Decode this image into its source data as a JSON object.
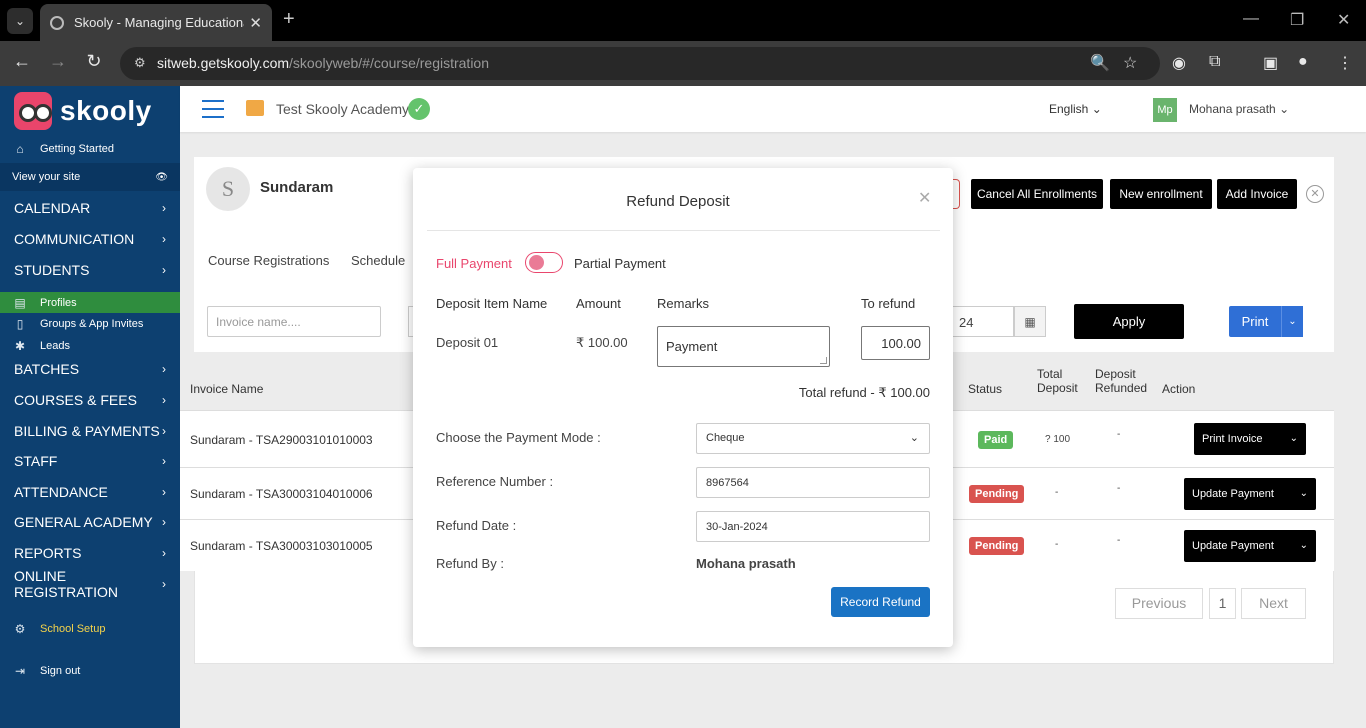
{
  "browser": {
    "tab_title": "Skooly - Managing Educational",
    "url_host": "sitweb.getskooly.com",
    "url_path": "/skoolyweb/#/course/registration"
  },
  "sidebar": {
    "brand": "skooly",
    "getting_started": "Getting Started",
    "view_site": "View your site",
    "menu": [
      {
        "label": "CALENDAR"
      },
      {
        "label": "COMMUNICATION"
      },
      {
        "label": "STUDENTS"
      }
    ],
    "students_sub": [
      {
        "label": "Profiles"
      },
      {
        "label": "Groups & App Invites"
      },
      {
        "label": "Leads"
      }
    ],
    "menu2": [
      {
        "label": "BATCHES"
      },
      {
        "label": "COURSES & FEES"
      },
      {
        "label": "BILLING & PAYMENTS"
      },
      {
        "label": "STAFF"
      },
      {
        "label": "ATTENDANCE"
      },
      {
        "label": "GENERAL ACADEMY"
      },
      {
        "label": "REPORTS"
      },
      {
        "label": "ONLINE REGISTRATION"
      }
    ],
    "school_setup": "School Setup",
    "sign_out": "Sign out"
  },
  "header": {
    "school_name": "Test Skooly Academy",
    "language": "English",
    "user_initials": "Mp",
    "user_name": "Mohana prasath"
  },
  "student": {
    "initial": "S",
    "name": "Sundaram"
  },
  "actions": {
    "cancel_all": "Cancel All Enrollments",
    "new_enrollment": "New enrollment",
    "add_invoice": "Add Invoice"
  },
  "tabs": {
    "course_registrations": "Course Registrations",
    "schedule": "Schedule"
  },
  "filters": {
    "invoice_placeholder": "Invoice name....",
    "date_tail": "24",
    "apply": "Apply",
    "print": "Print"
  },
  "table": {
    "headers": {
      "invoice_name": "Invoice Name",
      "status": "Status",
      "total_deposit": "Total Deposit",
      "deposit_refunded": "Deposit Refunded",
      "action": "Action"
    },
    "rows": [
      {
        "name": "Sundaram - TSA29003101010003",
        "status": "Paid",
        "status_color": "#5cb85c",
        "total_deposit": "? 100",
        "refunded": "-",
        "action": "Print Invoice"
      },
      {
        "name": "Sundaram - TSA30003104010006",
        "status": "Pending",
        "status_color": "#d9534f",
        "total_deposit": "-",
        "refunded": "-",
        "action": "Update Payment"
      },
      {
        "name": "Sundaram - TSA30003103010005",
        "status": "Pending",
        "status_color": "#d9534f",
        "total_deposit": "-",
        "refunded": "-",
        "action": "Update Payment"
      }
    ],
    "pagination": {
      "previous": "Previous",
      "page": "1",
      "next": "Next"
    }
  },
  "modal": {
    "title": "Refund Deposit",
    "full_payment": "Full Payment",
    "partial_payment": "Partial Payment",
    "col_item": "Deposit Item Name",
    "col_amount": "Amount",
    "col_remarks": "Remarks",
    "col_refund": "To refund",
    "item_name": "Deposit 01",
    "amount": "₹ 100.00",
    "remarks_value": "Payment",
    "refund_value": "100.00",
    "total_refund": "Total refund - ₹ 100.00",
    "payment_mode_label": "Choose the Payment Mode :",
    "payment_mode_value": "Cheque",
    "reference_label": "Reference Number :",
    "reference_value": "8967564",
    "refund_date_label": "Refund Date :",
    "refund_date_value": "30-Jan-2024",
    "refund_by_label": "Refund By :",
    "refund_by_value": "Mohana prasath",
    "record_button": "Record Refund"
  }
}
